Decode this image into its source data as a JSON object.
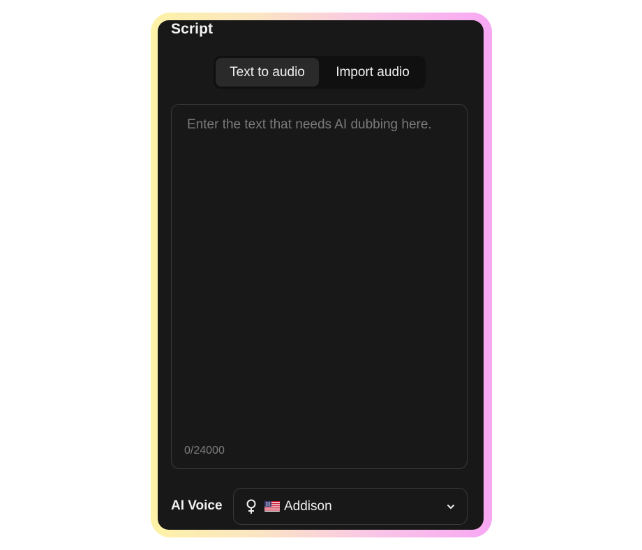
{
  "panel": {
    "title": "Script"
  },
  "tabs": [
    {
      "label": "Text to audio",
      "active": true
    },
    {
      "label": "Import audio",
      "active": false
    }
  ],
  "editor": {
    "placeholder": "Enter the text that needs AI dubbing here.",
    "value": "",
    "counter": "0/24000"
  },
  "voice": {
    "label": "AI Voice",
    "selected_name": "Addison",
    "gender_icon": "female-icon",
    "flag_icon": "us-flag-icon",
    "dropdown_icon": "chevron-down-icon"
  },
  "colors": {
    "panel_bg": "#181818",
    "tab_active_bg": "#2a2a2a",
    "tab_track_bg": "#101010",
    "border": "#3a3a3a",
    "gradient_start": "#fdf2a6",
    "gradient_end": "#f7a7f3"
  }
}
